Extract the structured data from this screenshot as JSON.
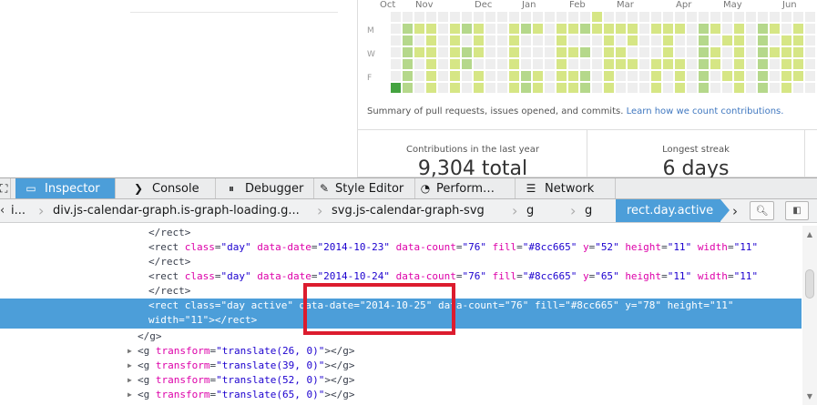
{
  "calendar": {
    "months": [
      "Oct",
      "Nov",
      "Dec",
      "Jan",
      "Feb",
      "Mar",
      "Apr",
      "May",
      "Jun"
    ],
    "day_labels": [
      "M",
      "W",
      "F"
    ],
    "summary_text": "Summary of pull requests, issues opened, and commits. ",
    "summary_link": "Learn how we count contributions.",
    "colors": {
      "empty": "#eeeeee",
      "light": "#d6e685",
      "medium": "#8cc665",
      "dark": "#44a340"
    }
  },
  "stats": {
    "contributions_label": "Contributions in the last year",
    "contributions_value": "9,304 total",
    "streak_label": "Longest streak",
    "streak_value": "6 days"
  },
  "toolbar": {
    "tabs": [
      {
        "label": "Inspector",
        "icon": "inspector-icon",
        "selected": true
      },
      {
        "label": "Console",
        "icon": "console-icon"
      },
      {
        "label": "Debugger",
        "icon": "debugger-icon"
      },
      {
        "label": "Style Editor",
        "icon": "style-editor-icon"
      },
      {
        "label": "Perform…",
        "icon": "performance-icon"
      },
      {
        "label": "Network",
        "icon": "network-icon"
      }
    ]
  },
  "breadcrumbs": {
    "first": "i...",
    "items": [
      "div.js-calendar-graph.is-graph-loading.g...",
      "svg.js-calendar-graph-svg",
      "g",
      "g"
    ],
    "selected": "rect.day.active"
  },
  "markup": {
    "line1": "</rect>",
    "rect1": {
      "class": "day",
      "date": "2014-10-23",
      "count": "76",
      "fill": "#8cc665",
      "y": "52",
      "height": "11",
      "width": "11"
    },
    "line3": "</rect>",
    "rect2": {
      "class": "day",
      "date": "2014-10-24",
      "count": "76",
      "fill": "#8cc665",
      "y": "65",
      "height": "11",
      "width": "11"
    },
    "line5": "</rect>",
    "selected": {
      "class": "day active",
      "date": "2014-10-25",
      "count": "76",
      "fill": "#8cc665",
      "y": "78",
      "height": "11",
      "width": "11"
    },
    "close_g": "</g>",
    "transforms": [
      "translate(26, 0)",
      "translate(39, 0)",
      "translate(52, 0)",
      "translate(65, 0)"
    ]
  },
  "accent": "#4c9ed9",
  "highlight_color": "#dc1c2e"
}
